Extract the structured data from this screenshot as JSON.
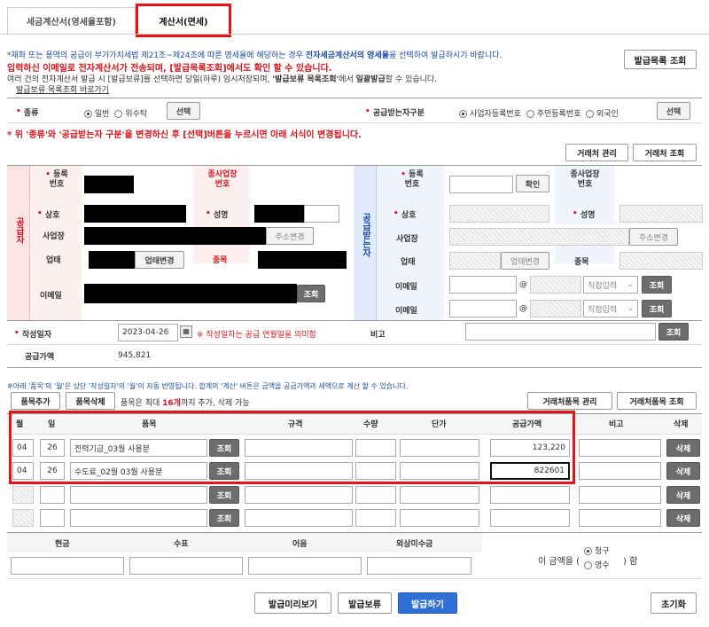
{
  "tabs": [
    "세금계산서(영세율포함)",
    "계산서(면세)"
  ],
  "notice": {
    "line1_pre": "*재화 또는 용역의 공급이 부가가치세법 제21조~제24조에 따른 영세율에 해당하는 경우 ",
    "line1_bold": "전자세금계산서의 영세율",
    "line1_post": "을 선택하여 발급하시기 바랍니다.",
    "line2": "입력하신 이메일로 전자계산서가 전송되며, [발급목록조회]에서도 확인 할 수 있습니다.",
    "line3_pre": "여러 건의 전자계산서 발급 시 [발급보류]를 선택하면 당일(하루) 임시저장되며, ",
    "line3_bold": "'발급보류 목록조회'",
    "line3_mid": "에서 ",
    "line3_bold2": "일괄발급",
    "line3_post": "할 수 있습니다.",
    "link": "발급보류 목록조회 바로가기",
    "issue_list_btn": "발급목록 조회"
  },
  "type_row": {
    "label": "종류",
    "opt_normal": "일반",
    "opt_consign": "위수탁",
    "select_btn": "선택",
    "receiver_label": "공급받는자구분",
    "opt_biz": "사업자등록번호",
    "opt_resident": "주민등록번호",
    "opt_foreign": "외국인",
    "select_btn2": "선택"
  },
  "warning": "* 위 '종류'와 '공급받는자 구분'을 변경하신 후 [선택]버튼을 누르시면 아래 서식이 변경됩니다.",
  "client_btns": [
    "거래처 관리",
    "거래처 조회"
  ],
  "supplier": {
    "side": "공급자",
    "reg_no": "등록번호",
    "branch_no": "종사업장번호",
    "name": "상호",
    "rep": "성명",
    "address": "사업장",
    "addr_btn": "주소변경",
    "biz_type": "업태",
    "biz_type_btn": "업태변경",
    "item": "종목",
    "email": "이메일",
    "email_btn": "조회"
  },
  "receiver": {
    "side": "공급받는자",
    "reg_no": "등록번호",
    "confirm_btn": "확인",
    "branch_no": "종사업장번호",
    "name": "상호",
    "rep": "성명",
    "address": "사업장",
    "addr_btn": "주소변경",
    "biz_type": "업태",
    "biz_type_btn": "업태변경",
    "item": "종목",
    "email": "이메일",
    "at": "@",
    "direct": "직접입력",
    "email_btn": "조회"
  },
  "date_row": {
    "label": "작성일자",
    "value": "2023-04-26",
    "note": "※ 작성일자는 공급 연월일을 의미함",
    "remark": "비고",
    "remark_btn": "조회"
  },
  "supply_row": {
    "label": "공급가액",
    "value": "945,821"
  },
  "items_note": "※아래 '품목'의 '월'은 상단 '작성일자'의 '월'이 자동 반영됩니다. 합계의 '계산' 버튼은 금액을 공급가액과 세액으로 계산 할 수 있습니다.",
  "items_btns": {
    "add": "품목추가",
    "del": "품목삭제",
    "max_pre": "품목은 최대 ",
    "max_bold": "16개",
    "max_post": "까지 추가, 삭제 가능",
    "manage": "거래처품목 관리",
    "lookup": "거래처품목 조회"
  },
  "table_headers": [
    "월",
    "일",
    "품목",
    "규격",
    "수량",
    "단가",
    "공급가액",
    "비고",
    "삭제"
  ],
  "rows": [
    {
      "month": "04",
      "day": "26",
      "item": "전력기금_03월 사용분",
      "amount": "123,220"
    },
    {
      "month": "04",
      "day": "26",
      "item": "수도료_02월 03월 사용분",
      "amount": "822601"
    },
    {
      "month": "",
      "day": "",
      "item": "",
      "amount": ""
    },
    {
      "month": "",
      "day": "",
      "item": "",
      "amount": ""
    }
  ],
  "row_btn": "조회",
  "del_btn": "삭제",
  "payment_headers": [
    "현금",
    "수표",
    "어음",
    "외상미수금"
  ],
  "payment_note_pre": "이 금액을 (",
  "payment_opt1": "청구",
  "payment_opt2": "영수",
  "payment_note_post": ") 함",
  "bottom_btns": {
    "preview": "발급미리보기",
    "hold": "발급보류",
    "issue": "발급하기",
    "reset": "초기화"
  }
}
